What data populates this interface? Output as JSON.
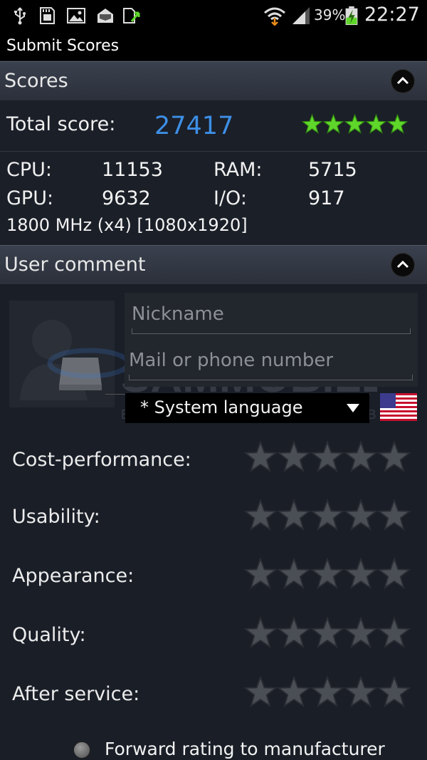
{
  "status_bar": {
    "icons": [
      "usb-icon",
      "sd-card-icon",
      "image-icon",
      "mail-icon",
      "app-update-icon",
      "wifi-icon",
      "signal-icon",
      "battery-charging-icon"
    ],
    "battery_percent": "39%",
    "time": "22:27"
  },
  "title_bar": {
    "title": "Submit Scores"
  },
  "scores": {
    "header": "Scores",
    "total_label": "Total score:",
    "total_value": "27417",
    "total_stars": 5,
    "star_color": "#5fd62a",
    "stats": [
      {
        "label": "CPU:",
        "value": "11153"
      },
      {
        "label": "RAM:",
        "value": "5715"
      },
      {
        "label": "GPU:",
        "value": "9632"
      },
      {
        "label": "I/O:",
        "value": "917"
      }
    ],
    "hardware": "1800 MHz (x4) [1080x1920]"
  },
  "user_comment": {
    "header": "User comment",
    "nickname_placeholder": "Nickname",
    "contact_placeholder": "Mail or phone number",
    "language": "* System language",
    "flag": "us-flag-icon",
    "ratings": [
      {
        "label": "Cost-performance:",
        "stars": 0
      },
      {
        "label": "Usability:",
        "stars": 0
      },
      {
        "label": "Appearance:",
        "stars": 0
      },
      {
        "label": "Quality:",
        "stars": 0
      },
      {
        "label": "After service:",
        "stars": 0
      }
    ],
    "empty_star_color": "#4a4e55",
    "forward_label": "Forward rating to manufacturer",
    "watermark": "SAMMOBILE",
    "watermark_tagline": "EVERYTHING FOR YOUR SAMSUNG MOBILE"
  }
}
